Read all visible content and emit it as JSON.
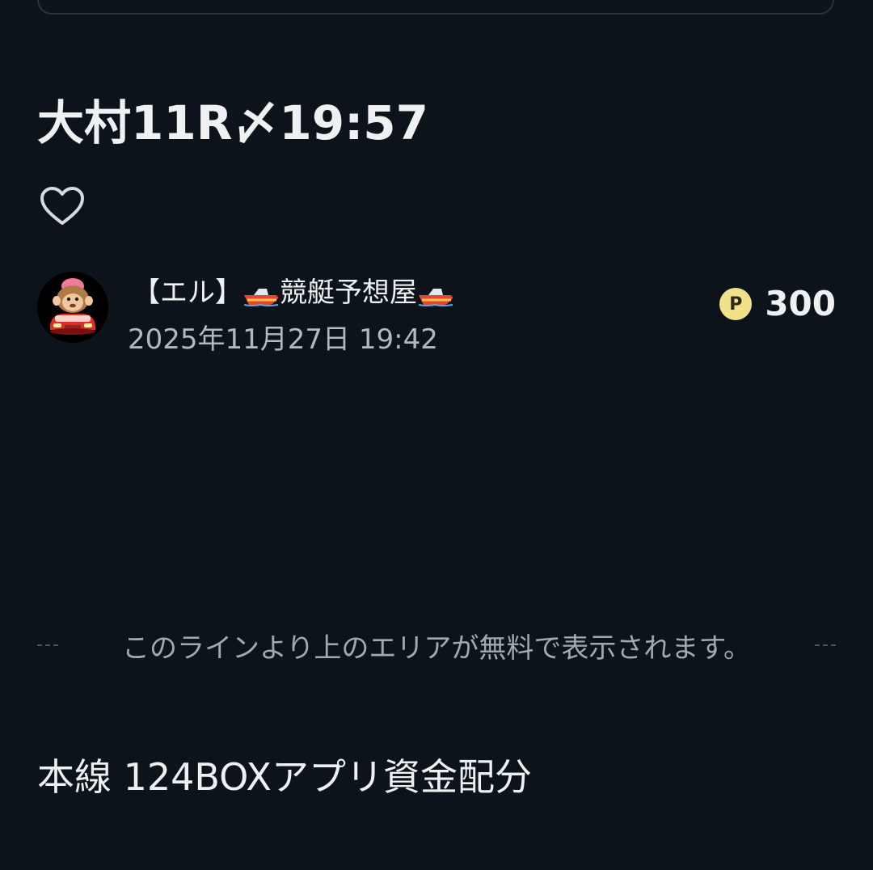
{
  "article": {
    "title": "大村11R〆19:57",
    "author": {
      "name_prefix": "【エル】",
      "name_main": "競艇予想屋",
      "avatar_icon": "monkey-car-avatar",
      "boat_icon": "speedboat-emoji"
    },
    "published_at": "2025年11月27日 19:42",
    "price": {
      "icon_label": "P",
      "value": "300",
      "icon_color": "#f1e28a"
    },
    "like_icon": "heart-outline-icon",
    "paywall_notice": "このラインより上のエリアが無料で表示されます。",
    "section_heading": "本線 124BOXアプリ資金配分"
  },
  "theme": {
    "background": "#0c131b",
    "text": "#eef0f2",
    "muted": "#b3b8be"
  }
}
